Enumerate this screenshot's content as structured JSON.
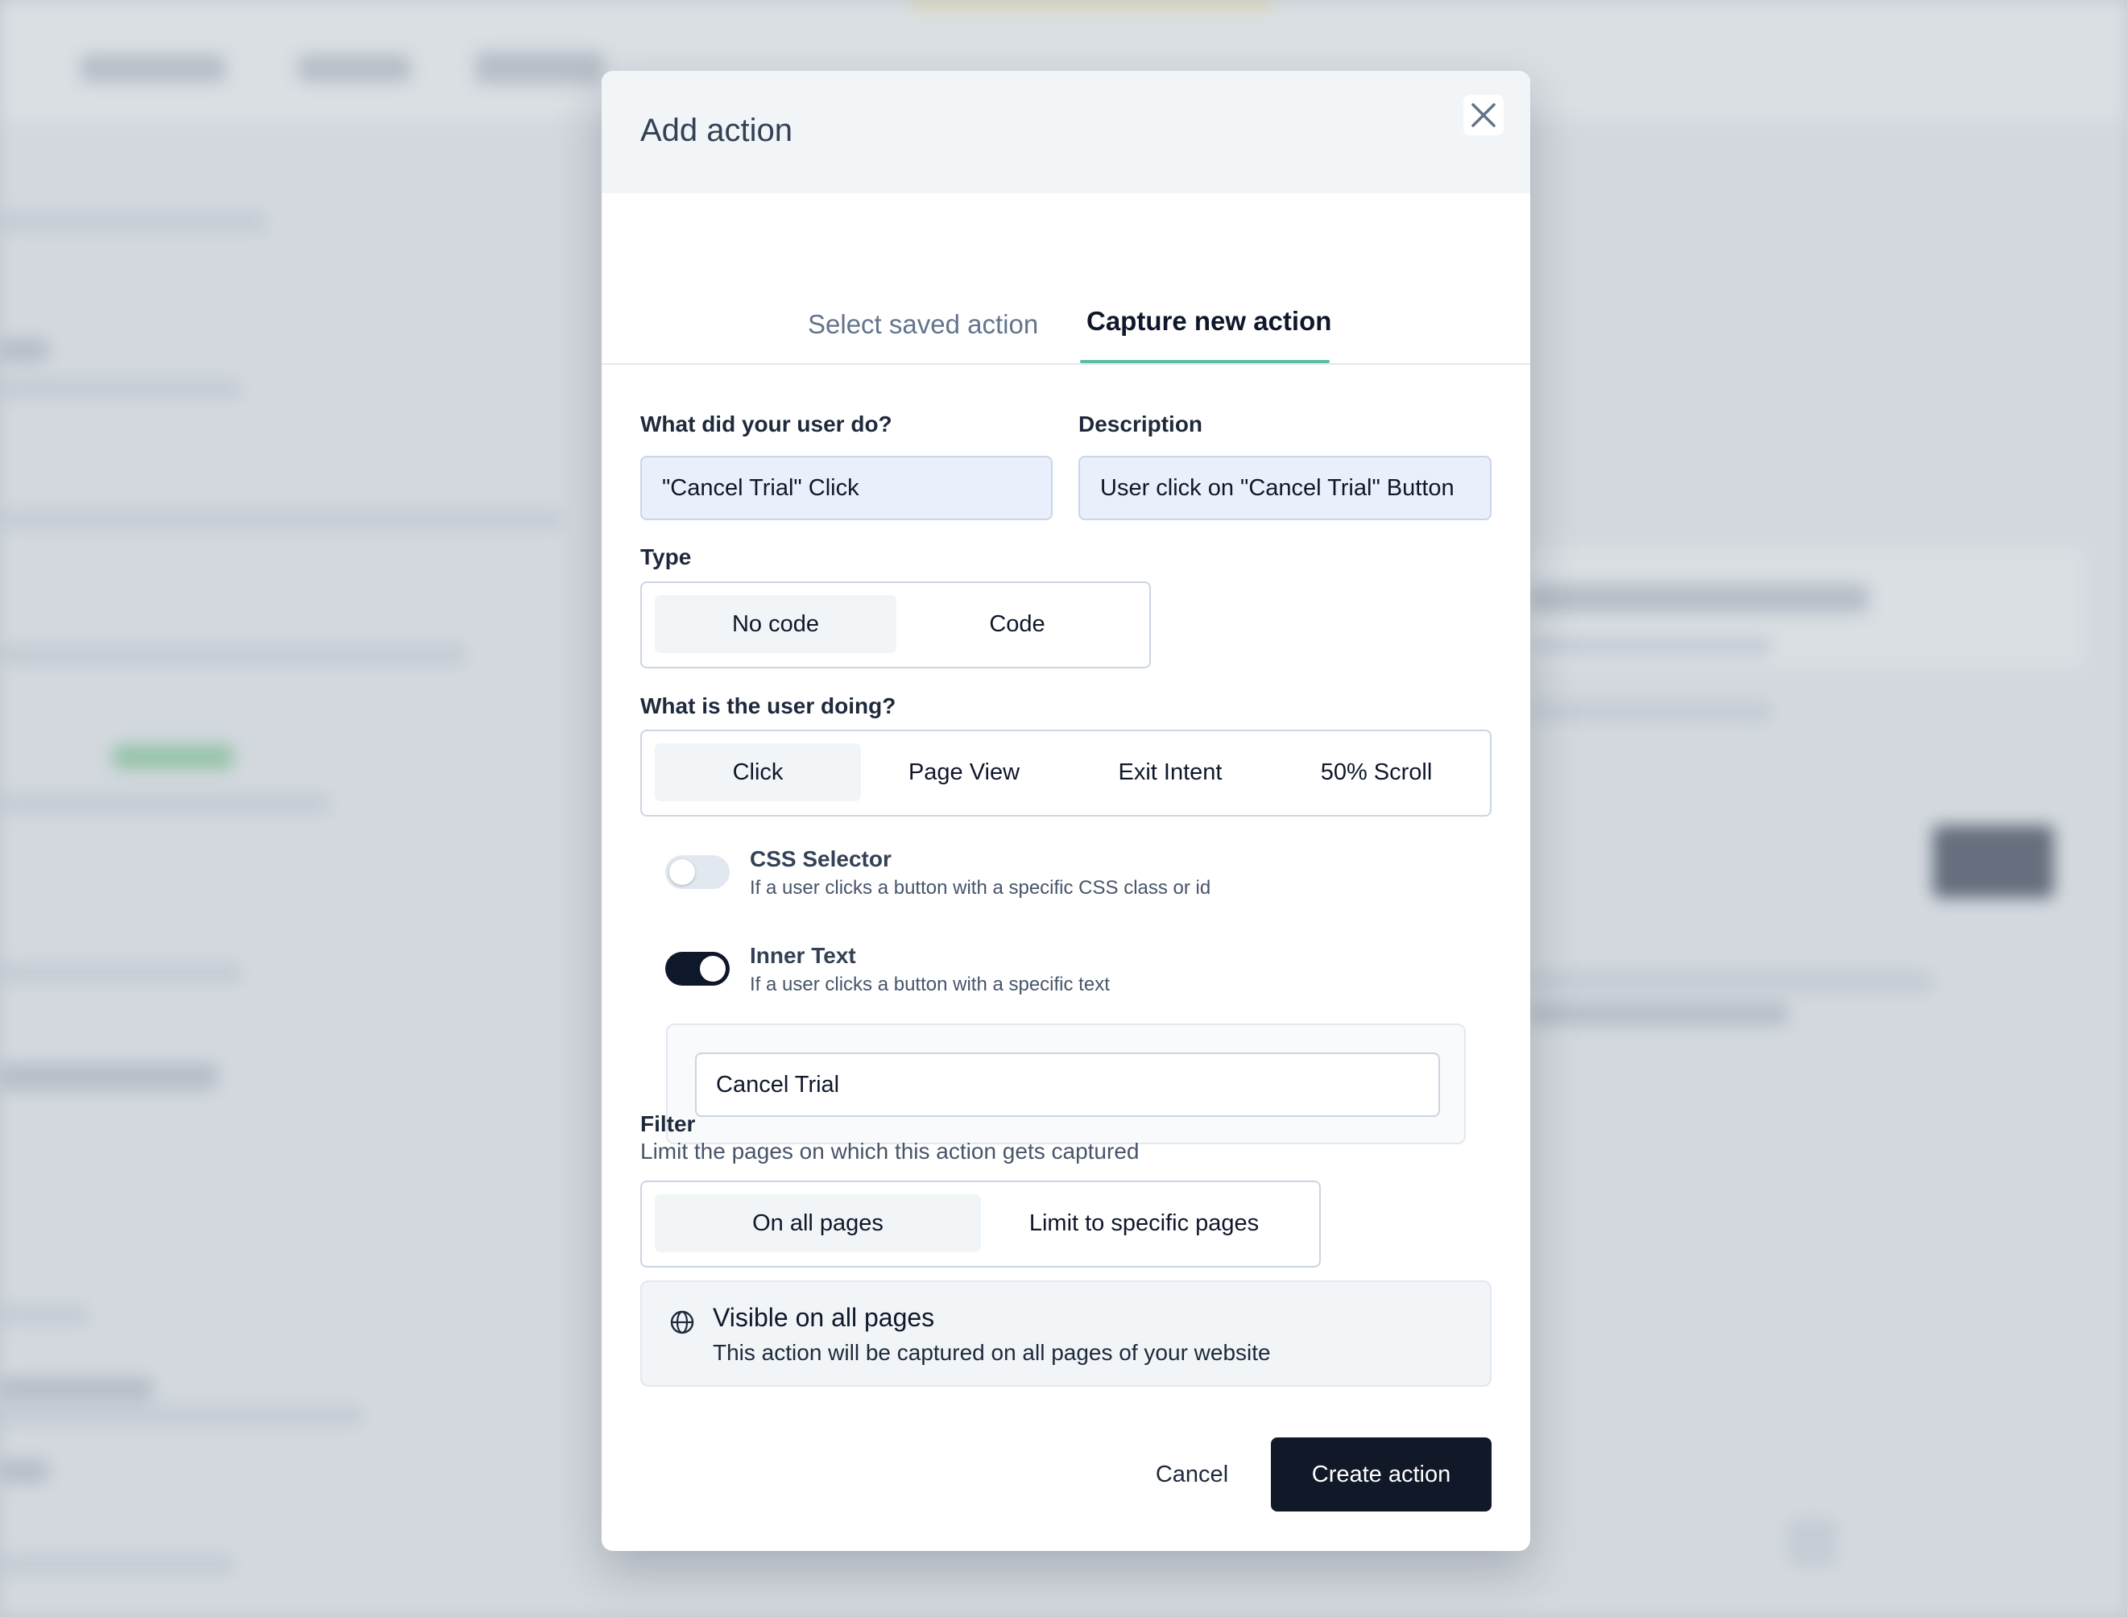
{
  "modal": {
    "title": "Add action"
  },
  "tabs": [
    {
      "label": "Select saved action",
      "active": false
    },
    {
      "label": "Capture new action",
      "active": true
    }
  ],
  "form": {
    "name_label": "What did your user do?",
    "name_value": "\"Cancel Trial\" Click",
    "description_label": "Description",
    "description_value": "User click on \"Cancel Trial\" Button",
    "type_label": "Type",
    "type_options": [
      "No code",
      "Code"
    ],
    "type_selected": "No code",
    "event_label": "What is the user doing?",
    "event_options": [
      "Click",
      "Page View",
      "Exit Intent",
      "50% Scroll"
    ],
    "event_selected": "Click",
    "css_selector": {
      "title": "CSS Selector",
      "description": "If a user clicks a button with a specific CSS class or id",
      "enabled": false
    },
    "inner_text": {
      "title": "Inner Text",
      "description": "If a user clicks a button with a specific text",
      "enabled": true,
      "value": "Cancel Trial"
    },
    "filter_label": "Filter",
    "filter_description": "Limit the pages on which this action gets captured",
    "filter_options": [
      "On all pages",
      "Limit to specific pages"
    ],
    "filter_selected": "On all pages",
    "info": {
      "icon": "globe-icon",
      "title": "Visible on all pages",
      "text": "This action will be captured on all pages of your website"
    }
  },
  "footer": {
    "cancel_label": "Cancel",
    "create_label": "Create action"
  },
  "colors": {
    "accent": "#5bbfa3",
    "primary_button": "#111827",
    "input_fill": "#e9effb"
  }
}
